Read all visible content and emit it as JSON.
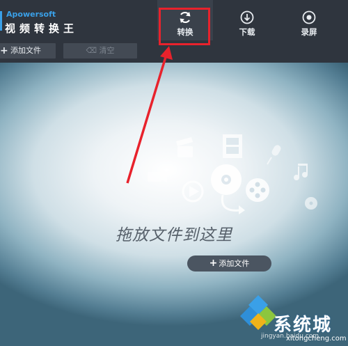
{
  "app": {
    "brand_en": "Apowersoft",
    "brand_cn": "视频转换王"
  },
  "tabs": [
    {
      "label": "转换",
      "icon": "refresh-icon"
    },
    {
      "label": "下载",
      "icon": "download-icon"
    },
    {
      "label": "录屏",
      "icon": "record-icon"
    }
  ],
  "toolbar": {
    "add_file_label": "添加文件",
    "clear_label": "清空"
  },
  "main": {
    "drop_hint": "拖放文件到这里",
    "add_file_button": "添加文件"
  },
  "watermark": {
    "baidu": "Baidu",
    "baidu_url": "jingyan.baidu.com",
    "site_cn": "系统城",
    "site_en": "xitongcheng.com"
  },
  "colors": {
    "accent": "#2c95e0",
    "highlight": "#e8222c",
    "header_bg": "#2f353e"
  }
}
